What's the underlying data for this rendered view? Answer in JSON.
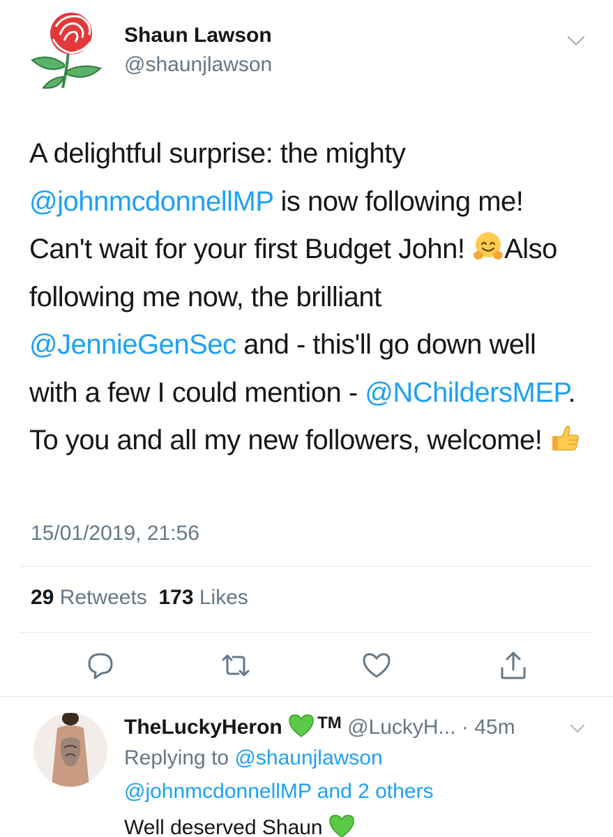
{
  "tweet": {
    "author_name": "Shaun Lawson",
    "author_handle": "@shaunjlawson",
    "text_segments": [
      "A delightful surprise: the mighty ",
      "@johnmcdonnellMP",
      " is now following me! Can't wait for your first Budget John! ",
      "Also following me now, the brilliant ",
      "@JennieGenSec",
      " and - this'll go down well with a few I could mention - ",
      "@NChildersMEP",
      ". To you and all my new followers, welcome! "
    ],
    "timestamp": "15/01/2019, 21:56",
    "retweets_count": "29",
    "retweets_label": "Retweets",
    "likes_count": "173",
    "likes_label": "Likes"
  },
  "icons": {
    "avatar": "labour-rose-logo",
    "menu": "chevron-down-icon",
    "actions": [
      "reply-icon",
      "retweet-icon",
      "like-icon",
      "share-icon"
    ],
    "emoji_1": "hugging-face-emoji",
    "emoji_2": "thumbs-up-emoji",
    "emoji_3": "green-heart-emoji"
  },
  "reply": {
    "author_name": "TheLuckyHeron",
    "tm": "TM",
    "handle_time": "@LuckyH... · 45m",
    "replying_to_label": "Replying to ",
    "replying_to_handle": "@shaunjlawson",
    "replying_to_line2": "@johnmcdonnellMP and 2 others",
    "text": "Well deserved Shaun "
  },
  "colors": {
    "accent": "#1da1f2",
    "secondary_text": "#657786",
    "primary_text": "#14171a",
    "divider": "#e1e8ed"
  }
}
